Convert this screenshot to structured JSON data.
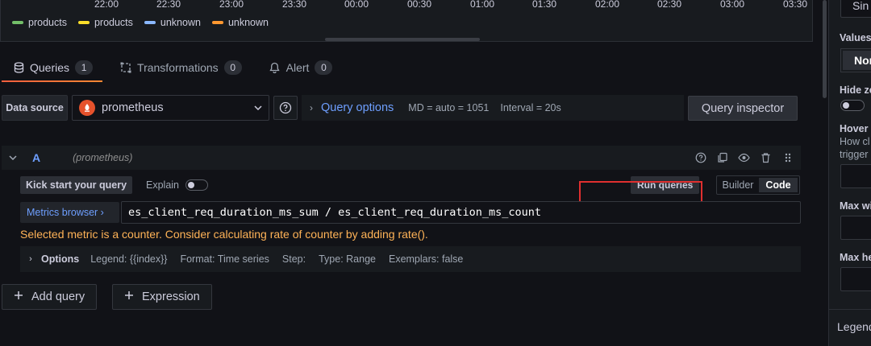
{
  "graph": {
    "time_ticks": [
      "22:00",
      "22:30",
      "23:00",
      "23:30",
      "00:00",
      "00:30",
      "01:00",
      "01:30",
      "02:00",
      "02:30",
      "03:00",
      "03:30"
    ],
    "legend": [
      {
        "label": "products",
        "color": "#73bf69"
      },
      {
        "label": "products",
        "color": "#fade2a"
      },
      {
        "label": "unknown",
        "color": "#8ab8ff"
      },
      {
        "label": "unknown",
        "color": "#ff9830"
      }
    ]
  },
  "tabs": [
    {
      "label": "Queries",
      "count": "1",
      "icon": "database-icon"
    },
    {
      "label": "Transformations",
      "count": "0",
      "icon": "transform-icon"
    },
    {
      "label": "Alert",
      "count": "0",
      "icon": "bell-icon"
    }
  ],
  "datasource": {
    "label": "Data source",
    "selected": "prometheus",
    "query_options_title": "Query options",
    "md": "MD = auto = 1051",
    "interval": "Interval = 20s",
    "inspector_label": "Query inspector"
  },
  "query": {
    "name": "A",
    "datasource_hint": "(prometheus)",
    "kick_start": "Kick start your query",
    "explain": "Explain",
    "run_queries": "Run queries",
    "mode_builder": "Builder",
    "mode_code": "Code",
    "metrics_browser": "Metrics browser ›",
    "expression": "es_client_req_duration_ms_sum / es_client_req_duration_ms_count",
    "warning": "Selected metric is a counter. Consider calculating rate of counter by adding rate().",
    "options": {
      "title": "Options",
      "legend": "Legend: {{index}}",
      "format": "Format: Time series",
      "step": "Step:",
      "type": "Type: Range",
      "exemplars": "Exemplars: false"
    }
  },
  "actions": {
    "add_query": "Add query",
    "expression": "Expression"
  },
  "right_panel": {
    "top_input": "Sin",
    "values_label": "Values",
    "values_selected": "Nor",
    "hide_label": "Hide ze",
    "hover_label": "Hover p",
    "hover_sub1": "How cl",
    "hover_sub2": "trigger",
    "max_width_label": "Max wi",
    "max_height_label": "Max he",
    "legend_section": "Legend"
  }
}
